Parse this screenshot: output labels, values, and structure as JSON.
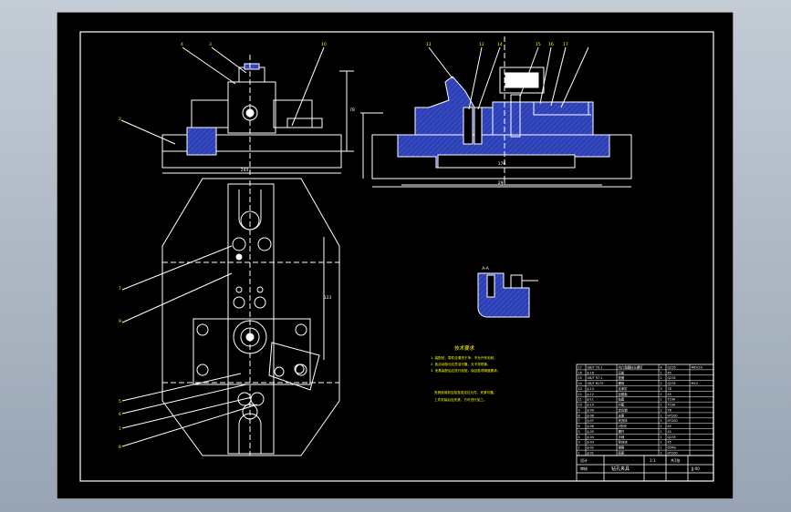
{
  "colors": {
    "line": "#ffffff",
    "section": "#2c3fb3",
    "note": "#ffff00",
    "background": "#000000",
    "viewport": "#aab4c0"
  },
  "drawing": {
    "title": "钻孔",
    "tech_req_title": "技术要求",
    "tech_req": [
      "1. 装配前，零件应清洗干净，不允许有毛刺。",
      "2. 各活动部分应灵活可靠，无卡滞现象。",
      "3. 夹具装配后应进行检验，保证各项精度要求。"
    ],
    "notes": [
      "夹具使用前应检查各定位元件，夹紧可靠。",
      "工件安装后应夹紧，方可进行加工。"
    ],
    "dims": {
      "top_width": "244",
      "section_width": "294",
      "section_inner": "176",
      "right_height": "78",
      "mid_height": "123"
    },
    "section_label": "A-A",
    "balloons": [
      "4",
      "3",
      "10",
      "2",
      "7",
      "9",
      "5",
      "6",
      "1",
      "8",
      "11",
      "12",
      "14",
      "15",
      "16",
      "17"
    ],
    "bom_rows": [
      [
        "17",
        "GB/T 70.1",
        "内六角圆柱头螺钉",
        "4",
        "Q235",
        "M6×20"
      ],
      [
        "16",
        "JJ-16",
        "压板",
        "1",
        "45",
        ""
      ],
      [
        "15",
        "GB/T 97.1",
        "垫圈",
        "2",
        "Q235",
        ""
      ],
      [
        "14",
        "GB/T 6170",
        "螺母",
        "2",
        "Q235",
        "M10"
      ],
      [
        "13",
        "JJ-13",
        "支承钉",
        "3",
        "T8",
        ""
      ],
      [
        "12",
        "JJ-12",
        "钻模板",
        "1",
        "45",
        ""
      ],
      [
        "11",
        "JJ-11",
        "钻套",
        "1",
        "T10A",
        ""
      ],
      [
        "10",
        "JJ-10",
        "衬套",
        "1",
        "T10A",
        ""
      ],
      [
        "9",
        "JJ-09",
        "定位销",
        "2",
        "T8",
        ""
      ],
      [
        "8",
        "JJ-08",
        "支座",
        "1",
        "HT200",
        ""
      ],
      [
        "7",
        "JJ-07",
        "夹具体",
        "1",
        "HT200",
        ""
      ],
      [
        "6",
        "JJ-06",
        "V形块",
        "1",
        "45",
        ""
      ],
      [
        "5",
        "JJ-05",
        "螺杆",
        "1",
        "45",
        ""
      ],
      [
        "4",
        "JJ-04",
        "手柄",
        "1",
        "Q235",
        ""
      ],
      [
        "3",
        "JJ-03",
        "导向块",
        "1",
        "45",
        ""
      ],
      [
        "2",
        "JJ-02",
        "弹簧",
        "1",
        "65Mn",
        ""
      ],
      [
        "1",
        "JJ-01",
        "底座",
        "1",
        "HT200",
        ""
      ]
    ],
    "title_block": {
      "title": "钻孔夹具",
      "scale": "1:1",
      "sheet": "共1张",
      "drawn": "设计",
      "checked": "审核",
      "code": "JJ-00"
    }
  }
}
